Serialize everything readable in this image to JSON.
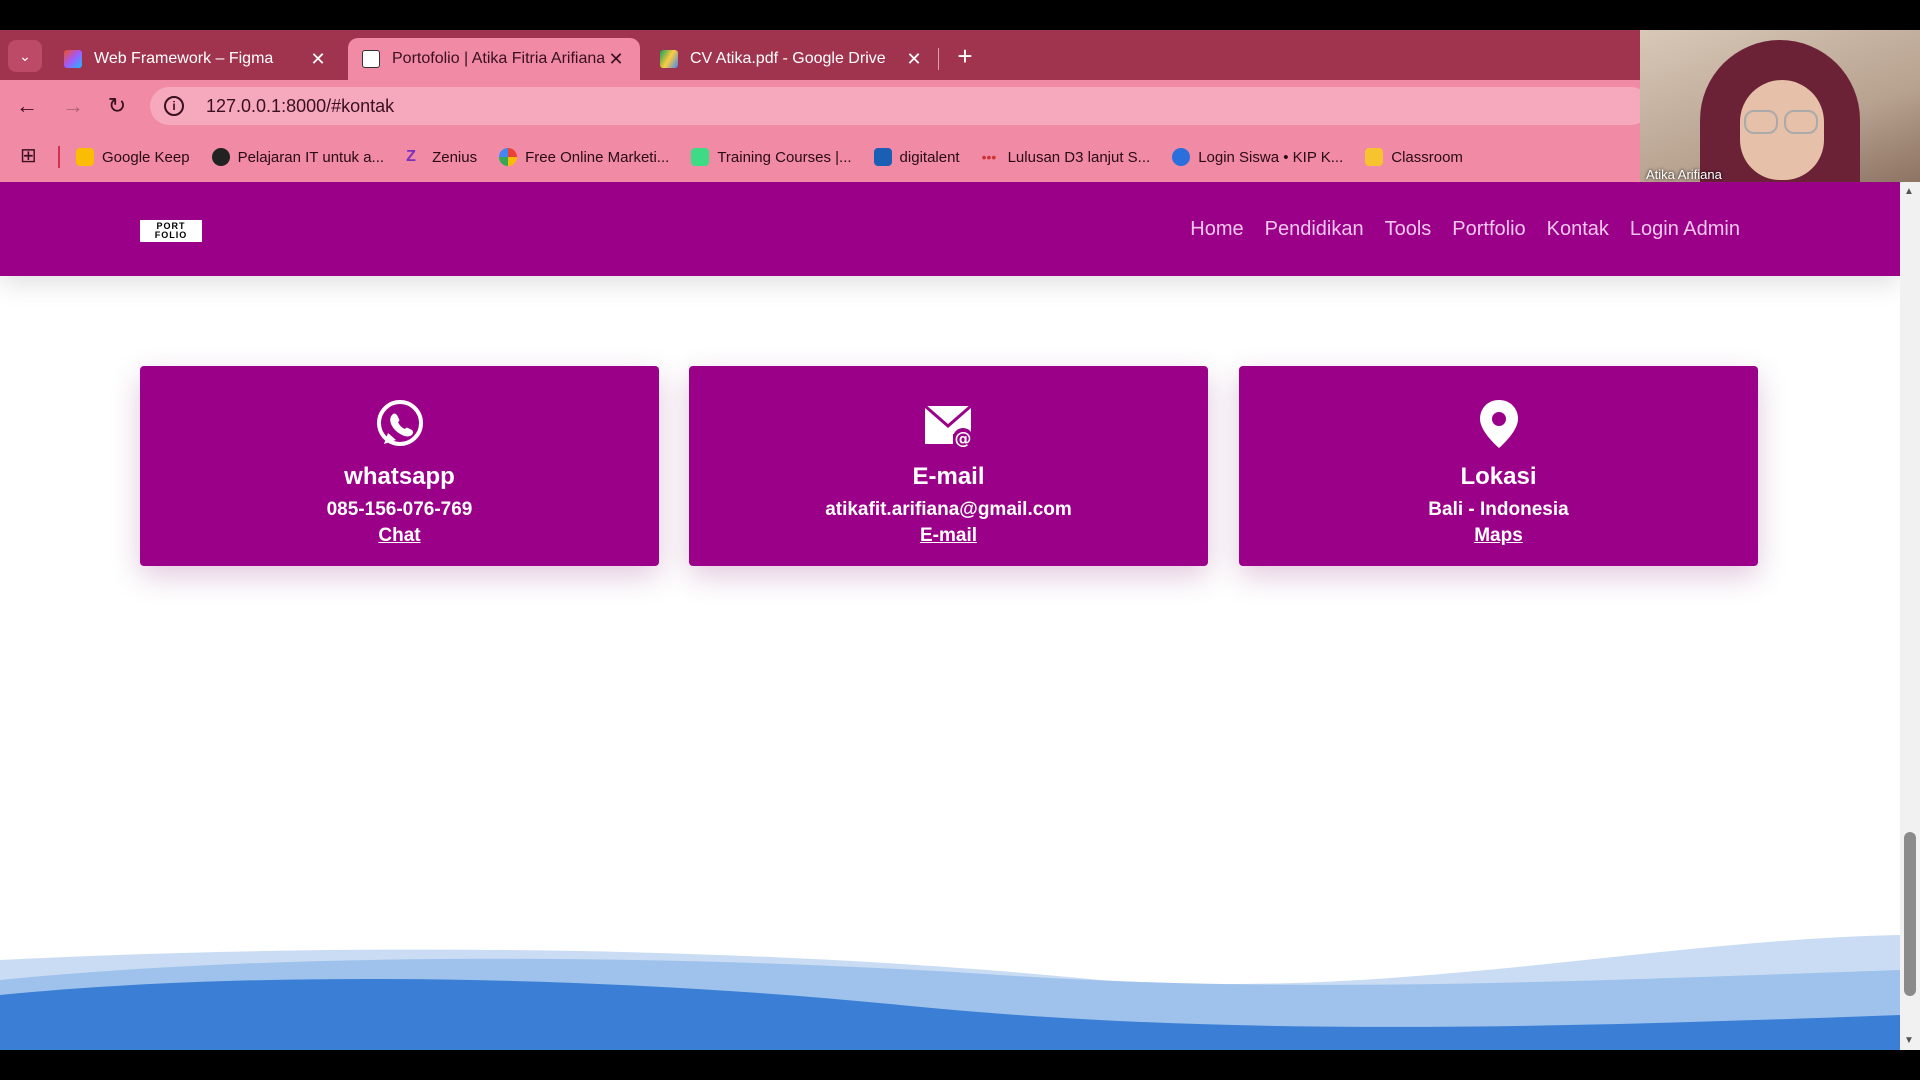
{
  "browser": {
    "tabs": [
      {
        "title": "Web Framework – Figma",
        "favicon": "figma-icon"
      },
      {
        "title": "Portofolio | Atika Fitria Arifiana",
        "favicon": "portfolio-icon"
      },
      {
        "title": "CV Atika.pdf - Google Drive",
        "favicon": "google-drive-icon"
      }
    ],
    "url": "127.0.0.1:8000/#kontak",
    "bookmarks": [
      {
        "label": "Google Keep",
        "icon": "google-keep-icon"
      },
      {
        "label": "Pelajaran IT untuk a...",
        "icon": "globe-icon"
      },
      {
        "label": "Zenius",
        "icon": "zenius-icon"
      },
      {
        "label": "Free Online Marketi...",
        "icon": "google-icon"
      },
      {
        "label": "Training Courses |...",
        "icon": "android-icon"
      },
      {
        "label": "digitalent",
        "icon": "digitalent-icon"
      },
      {
        "label": "Lulusan D3 lanjut S...",
        "icon": "dots-icon"
      },
      {
        "label": "Login Siswa • KIP K...",
        "icon": "kip-icon"
      },
      {
        "label": "Classroom",
        "icon": "classroom-icon"
      }
    ]
  },
  "webcam": {
    "name": "Atika Arifiana"
  },
  "site": {
    "logo_text": "PORT FOLIO",
    "nav": [
      "Home",
      "Pendidikan",
      "Tools",
      "Portfolio",
      "Kontak",
      "Login Admin"
    ],
    "cards": [
      {
        "icon": "whatsapp-icon",
        "heading": "whatsapp",
        "value": "085-156-076-769",
        "link": "Chat"
      },
      {
        "icon": "email-icon",
        "heading": "E-mail",
        "value": "atikafit.arifiana@gmail.com",
        "link": "E-mail"
      },
      {
        "icon": "location-pin-icon",
        "heading": "Lokasi",
        "value": "Bali - Indonesia",
        "link": "Maps"
      }
    ]
  },
  "colors": {
    "brand": "#9b0089",
    "browser_frame": "#a0344f",
    "toolbar": "#f08aa5",
    "wave_blue": "#3a7fd5"
  }
}
